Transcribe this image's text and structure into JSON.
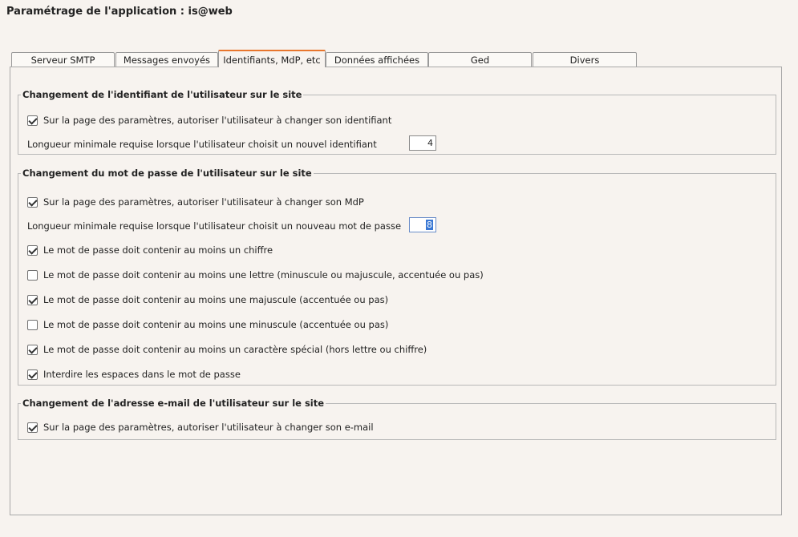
{
  "header": {
    "title": "Paramétrage de l'application : is@web"
  },
  "tabs": [
    {
      "label": "Serveur SMTP",
      "active": false
    },
    {
      "label": "Messages envoyés",
      "active": false
    },
    {
      "label": "Identifiants, MdP, etc",
      "active": true
    },
    {
      "label": "Données affichées",
      "active": false
    },
    {
      "label": "Ged",
      "active": false
    },
    {
      "label": "Divers",
      "active": false
    }
  ],
  "sections": {
    "identifiant": {
      "legend": "Changement de l'identifiant de l'utilisateur sur le site",
      "allow_change": {
        "label": "Sur la page des paramètres, autoriser l'utilisateur à changer son identifiant",
        "checked": true
      },
      "min_length": {
        "label": "Longueur minimale requise lorsque l'utilisateur choisit un nouvel identifiant",
        "value": "4"
      }
    },
    "password": {
      "legend": "Changement du mot de passe de l'utilisateur sur le site",
      "allow_change": {
        "label": "Sur la page des paramètres, autoriser l'utilisateur à changer son MdP",
        "checked": true
      },
      "min_length": {
        "label": "Longueur minimale requise lorsque l'utilisateur choisit un nouveau mot de passe",
        "value": "8"
      },
      "rules": [
        {
          "label": "Le mot de passe doit contenir au moins un chiffre",
          "checked": true
        },
        {
          "label": "Le mot de passe doit contenir au moins une lettre (minuscule ou majuscule, accentuée ou pas)",
          "checked": false
        },
        {
          "label": "Le mot de passe doit contenir au moins une majuscule (accentuée ou pas)",
          "checked": true
        },
        {
          "label": "Le mot de passe doit contenir au moins une minuscule (accentuée ou pas)",
          "checked": false
        },
        {
          "label": "Le mot de passe doit contenir au moins un caractère spécial (hors lettre ou chiffre)",
          "checked": true
        },
        {
          "label": "Interdire les espaces dans le mot de passe",
          "checked": true
        }
      ]
    },
    "email": {
      "legend": "Changement de l'adresse e-mail de l'utilisateur sur le site",
      "allow_change": {
        "label": "Sur la page des paramètres, autoriser l'utilisateur à changer son e-mail",
        "checked": true
      }
    }
  }
}
